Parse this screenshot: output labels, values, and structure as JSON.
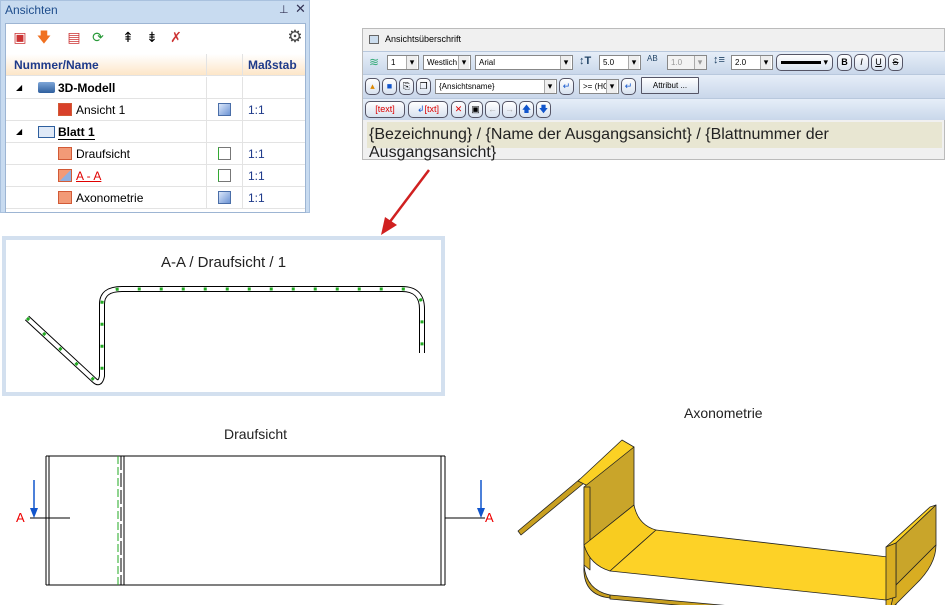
{
  "panel": {
    "title": "Ansichten",
    "pin_icon": "pin-icon",
    "close_icon": "close-icon",
    "columns": {
      "name": "Nummer/Name",
      "scale": "Maßstab"
    },
    "rows": [
      {
        "name": "3D-Modell",
        "level": 0,
        "scale": ""
      },
      {
        "name": "Ansicht 1",
        "level": 1,
        "scale": "1:1"
      },
      {
        "name": "Blatt 1",
        "level": 0,
        "scale": ""
      },
      {
        "name": "Draufsicht",
        "level": 1,
        "scale": "1:1"
      },
      {
        "name": "A - A",
        "level": 1,
        "scale": "1:1"
      },
      {
        "name": "Axonometrie",
        "level": 1,
        "scale": "1:1"
      }
    ]
  },
  "dialog": {
    "title": "Ansichtsüberschrift",
    "layer": "1",
    "script": "Westlich",
    "font": "Arial",
    "height": "5.0",
    "width": "1.0",
    "line_spacing": "2.0",
    "bold": "B",
    "italic": "I",
    "underline": "U",
    "strike": "S",
    "attribute_select": "{Ansichtsname}",
    "condition_select": ">= (HC",
    "attribut_button": "Attribut ...",
    "text_button": "text",
    "txt_button": "txt",
    "text": "{Bezeichnung} / {Name der Ausgangsansicht} / {Blattnummer der Ausgangsansicht}"
  },
  "views": {
    "section_title": "A-A / Draufsicht / 1",
    "top_title": "Draufsicht",
    "axo_title": "Axonometrie",
    "section_mark": "A"
  },
  "colors": {
    "accent": "#1e4d8c",
    "highlight": "#e00000",
    "part": "#fbd124"
  }
}
